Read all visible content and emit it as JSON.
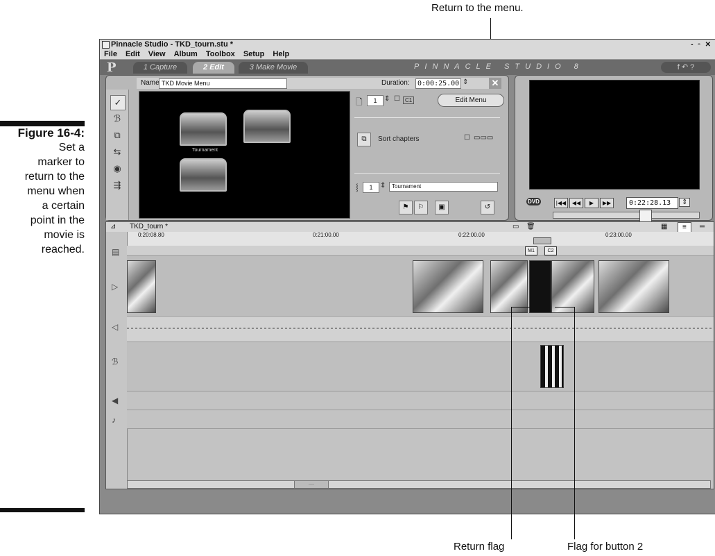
{
  "callouts": {
    "top": "Return to the menu.",
    "return_flag": "Return flag",
    "flag_button2": "Flag for button 2"
  },
  "figure": {
    "label": "Figure 16-4:",
    "line1": "Set a",
    "line2": "marker to",
    "line3": "return to the",
    "line4": "menu when",
    "line5": "a certain",
    "line6": "point in the",
    "line7": "movie is",
    "line8": "reached."
  },
  "window": {
    "title": "Pinnacle Studio - TKD_tourn.stu *",
    "buttons": "- ▫ ✕"
  },
  "menu": [
    "File",
    "Edit",
    "View",
    "Album",
    "Toolbox",
    "Setup",
    "Help"
  ],
  "tabs": {
    "logo": "P",
    "capture": "1 Capture",
    "edit": "2 Edit",
    "make": "3 Make Movie",
    "brand": "PINNACLE STUDIO 8",
    "right_icons": "f  ↶  ?"
  },
  "editor": {
    "name_label": "Name:",
    "name_value": "TKD Movie Menu",
    "duration_label": "Duration:",
    "duration_value": "0:00:25.00",
    "page_value": "1",
    "chapter_badge": "C1",
    "edit_menu_label": "Edit Menu",
    "sort_label": "Sort chapters",
    "button_index": "1",
    "button_name": "Tournament",
    "thumb_caption": "Tournament"
  },
  "player": {
    "timecode": "0:22:28.13",
    "dvd_label": "DVD"
  },
  "timeline": {
    "project": "TKD_tourn *",
    "ticks": [
      "0:20:08.80",
      "0:21:00.00",
      "0:22:00.00",
      "0:23:00.00"
    ],
    "marker_m1": "M1",
    "marker_c2": "C2"
  }
}
